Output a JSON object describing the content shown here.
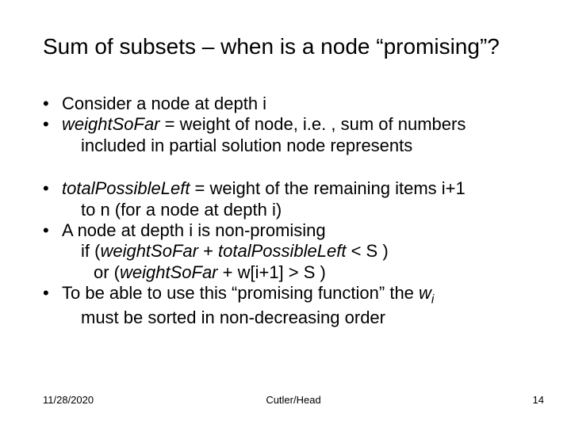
{
  "title": "Sum of subsets – when is a node “promising”?",
  "bullets_a": {
    "b1": "Consider a node at depth i",
    "b2_pre": "weightSoFar",
    "b2_mid": " = weight of node, i.e. , sum of numbers ",
    "b2_cont": "included in partial solution node represents"
  },
  "bullets_b": {
    "b3_pre": "totalPossibleLeft",
    "b3_mid": " =  weight of the remaining items i+1 ",
    "b3_cont": "to n (for a node at depth i)",
    "b4_l1": "A node at depth i is non-promising",
    "b4_l2a": "if   (",
    "b4_l2b": "weightSoFar",
    "b4_l2c": " +  ",
    "b4_l2d": "totalPossibleLeft",
    "b4_l2e": " < S )",
    "b4_l3a": "or (",
    "b4_l3b": "weightSoFar",
    "b4_l3c": "  + w[i+1] > S )",
    "b5_a": "To be able to use this “promising function” the ",
    "b5_w": "w",
    "b5_i": "i",
    "b5_c": "must be sorted in non-decreasing order"
  },
  "footer": {
    "date": "11/28/2020",
    "center": "Cutler/Head",
    "page": "14"
  }
}
